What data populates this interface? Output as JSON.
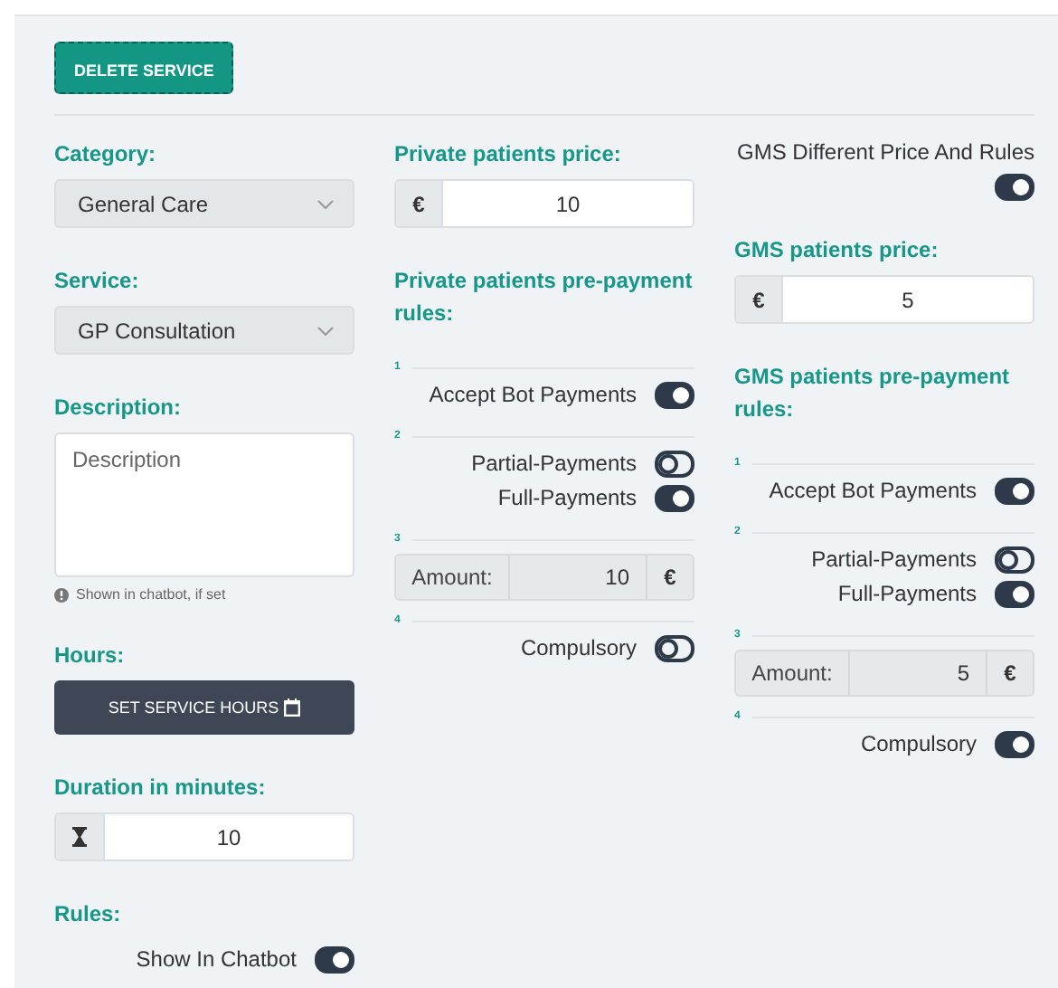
{
  "delete_button": "DELETE SERVICE",
  "category": {
    "label": "Category:",
    "value": "General Care"
  },
  "service": {
    "label": "Service:",
    "value": "GP Consultation"
  },
  "description": {
    "label": "Description:",
    "placeholder": "Description",
    "hint": "Shown in chatbot, if set"
  },
  "hours": {
    "label": "Hours:",
    "button": "SET SERVICE HOURS"
  },
  "duration": {
    "label": "Duration in **minutes**:",
    "value": "10"
  },
  "rules": {
    "label": "Rules:",
    "toggles": [
      {
        "label": "Show In Chatbot",
        "on": true
      }
    ]
  },
  "private": {
    "price_label": "Private patients price:",
    "currency": "€",
    "price": "10",
    "rules_label": "Private patients pre-payment rules:",
    "steps": [
      {
        "number": "1",
        "kind": "toggles",
        "toggles": [
          {
            "label": "Accept Bot Payments",
            "on": true
          }
        ]
      },
      {
        "number": "2",
        "kind": "toggles",
        "toggles": [
          {
            "label": "Partial-Payments",
            "on": false
          },
          {
            "label": "Full-Payments",
            "on": true
          }
        ]
      },
      {
        "number": "3",
        "kind": "amount",
        "label": "Amount:",
        "value": "10",
        "currency": "€"
      },
      {
        "number": "4",
        "kind": "toggles",
        "toggles": [
          {
            "label": "Compulsory",
            "on": false
          }
        ]
      }
    ]
  },
  "gms_different": {
    "label": "GMS Different Price And Rules",
    "on": true
  },
  "gms": {
    "price_label": "GMS patients price:",
    "currency": "€",
    "price": "5",
    "rules_label": "GMS patients pre-payment rules:",
    "steps": [
      {
        "number": "1",
        "kind": "toggles",
        "toggles": [
          {
            "label": "Accept Bot Payments",
            "on": true
          }
        ]
      },
      {
        "number": "2",
        "kind": "toggles",
        "toggles": [
          {
            "label": "Partial-Payments",
            "on": false
          },
          {
            "label": "Full-Payments",
            "on": true
          }
        ]
      },
      {
        "number": "3",
        "kind": "amount",
        "label": "Amount:",
        "value": "5",
        "currency": "€"
      },
      {
        "number": "4",
        "kind": "toggles",
        "toggles": [
          {
            "label": "Compulsory",
            "on": true
          }
        ]
      }
    ]
  }
}
